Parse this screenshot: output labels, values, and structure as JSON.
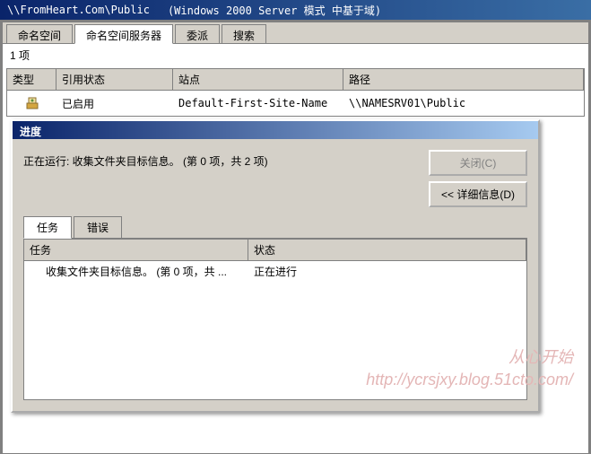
{
  "titlebar": {
    "path": "\\\\FromHeart.Com\\Public",
    "mode": "(Windows 2000 Server 模式 中基于域)"
  },
  "tabs": {
    "items": [
      "命名空间",
      "命名空间服务器",
      "委派",
      "搜索"
    ],
    "activeIndex": 1
  },
  "count": "1 项",
  "table": {
    "headers": [
      "类型",
      "引用状态",
      "站点",
      "路径"
    ],
    "row": {
      "status": "已启用",
      "site": "Default-First-Site-Name",
      "path": "\\\\NAMESRV01\\Public"
    }
  },
  "dialog": {
    "title": "进度",
    "status": "正在运行: 收集文件夹目标信息。 (第 0 项，共 2 项)",
    "buttons": {
      "close": "关闭(C)",
      "details": "<< 详细信息(D)"
    },
    "subtabs": {
      "items": [
        "任务",
        "错误"
      ],
      "activeIndex": 0
    },
    "subtable": {
      "headers": [
        "任务",
        "状态"
      ],
      "row": {
        "task": "收集文件夹目标信息。 (第 0 项，共 ...",
        "state": "正在进行"
      }
    }
  },
  "watermark": {
    "l1": "从心开始",
    "l2": "http://ycrsjxy.blog.51cto.com/"
  }
}
